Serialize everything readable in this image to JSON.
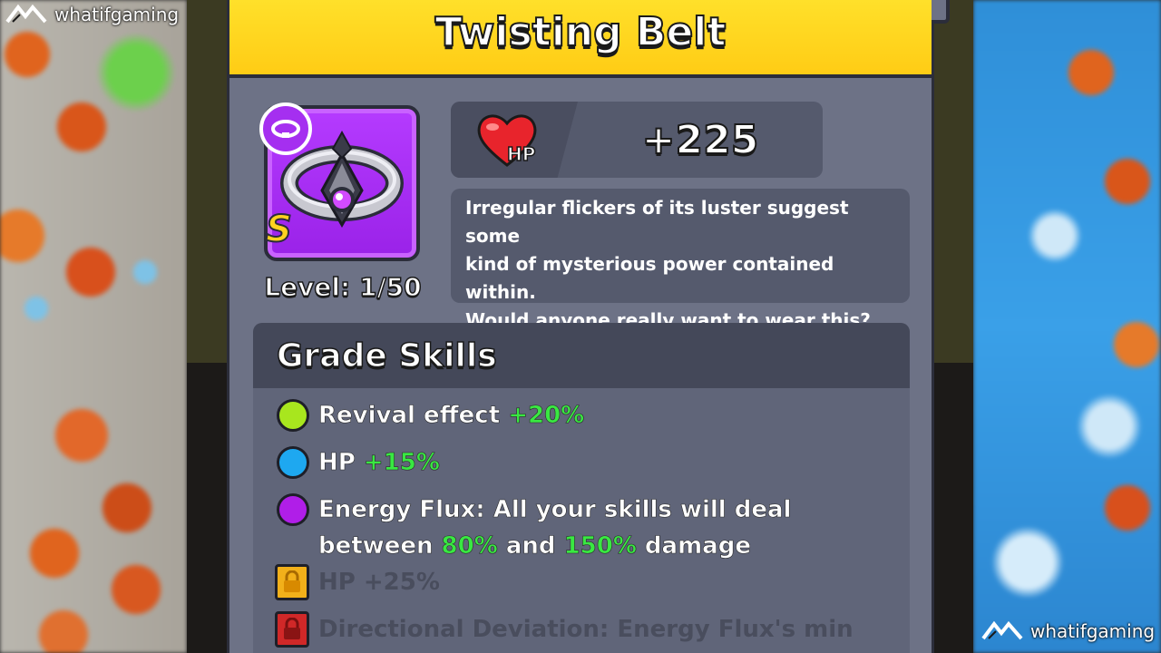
{
  "watermark": {
    "text": "whatifgaming"
  },
  "item": {
    "name": "Twisting Belt",
    "grade_letter": "S",
    "level": "Level: 1/50",
    "rarity_color": "#b53bff"
  },
  "stat": {
    "icon_label": "HP",
    "value": "+225"
  },
  "description": [
    "Irregular flickers of its luster suggest some",
    "kind of mysterious power contained within.",
    "Would anyone really want to wear this?"
  ],
  "grade_skills": {
    "title": "Grade Skills",
    "skills": [
      {
        "color": "#a8e61e",
        "icon": "green-dot",
        "name": "Revival effect ",
        "bonus": "+20%",
        "locked": false
      },
      {
        "color": "#1ea8f0",
        "icon": "blue-dot",
        "name": "HP ",
        "bonus": "+15%",
        "locked": false
      },
      {
        "color": "#b01ee8",
        "icon": "purple-dot",
        "line1": "Energy Flux: All your skills will deal",
        "line2_a": "between ",
        "line2_b": "80%",
        "line2_c": " and ",
        "line2_d": "150%",
        "line2_e": " damage",
        "locked": false
      },
      {
        "color": "#f2b01a",
        "icon": "lock-icon-gold",
        "name": "HP +25%",
        "locked": true
      },
      {
        "color": "#d02828",
        "icon": "lock-icon-red",
        "name": "Directional Deviation: Energy Flux's min",
        "locked": true
      }
    ]
  }
}
